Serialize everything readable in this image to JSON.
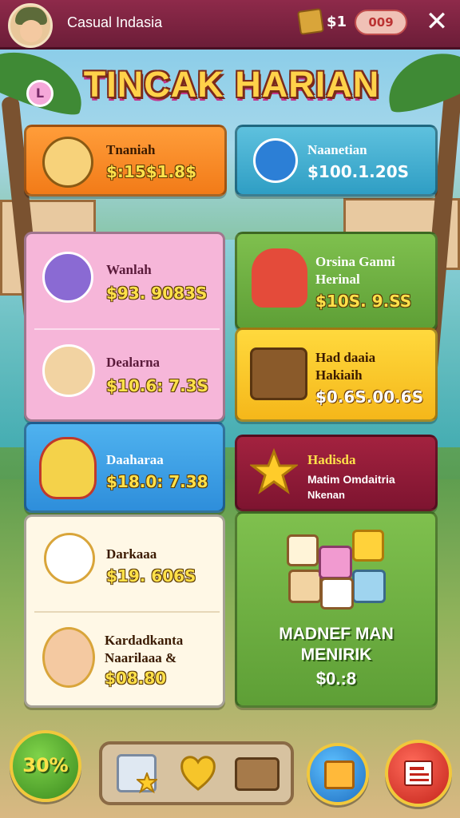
{
  "header": {
    "app_title": "Casual Indasia",
    "coin_count": "$1",
    "gem_count": "009",
    "close_label": "✕"
  },
  "title": {
    "level": "L",
    "text": "TINCAK HARIAN"
  },
  "cards": {
    "top_left": {
      "name": "Tnaniah",
      "price": "$:15$1.8$"
    },
    "top_right": {
      "name": "Naanetian",
      "price": "$100.1.20S"
    },
    "pink_1": {
      "name": "Wanlah",
      "price": "$93. 9083S"
    },
    "pink_2": {
      "name": "Dealarna",
      "price": "$10.6: 7.3S"
    },
    "green_1": {
      "name_line1": "Orsina Ganni",
      "name_line2": "Herinal",
      "price": "$10S. 9.SS"
    },
    "yellow_1": {
      "name_line1": "Had daaia",
      "name_line2": "Hakiaih",
      "price": "$0.6S.00.6S"
    },
    "blue_1": {
      "name": "Daaharaa",
      "price": "$18.0: 7.38"
    },
    "maroon_1": {
      "name": "Hadisda",
      "desc_line1": "Matim Omdaitria",
      "desc_line2": "Nkenan"
    },
    "cream_1": {
      "name": "Darkaaa",
      "price": "$19. 606S"
    },
    "cream_2": {
      "name_line1": "Kardadkanta",
      "name_line2": "Naarilaaa &",
      "price": "$08.80"
    },
    "bundle": {
      "title_line1": "MADNEF MAN",
      "title_line2": "MENIRIK",
      "price": "$0.:8"
    }
  },
  "bottom": {
    "percent": "30%"
  },
  "colors": {
    "header_bg": "#8e2a4a",
    "title_fill": "#ffd24a",
    "price_fill": "#ffe14a"
  },
  "icons": [
    "avatar",
    "coin-crate-icon",
    "close-icon",
    "chest-icon",
    "heart-icon",
    "crate-icon",
    "gift-icon",
    "menu-card-icon",
    "star-icon",
    "blocks-icon"
  ]
}
